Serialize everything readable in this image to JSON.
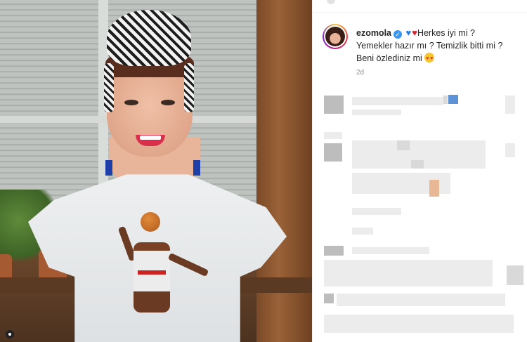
{
  "post": {
    "username": "ezomola",
    "verified": true,
    "caption_line1": "Herkes iyi mi ?",
    "caption_line2": "Yemekler hazır mı ? Temizlik bitti mi ?",
    "caption_line3": "Beni özlediniz mi",
    "timestamp": "2d"
  },
  "icons": {
    "verified": "verified-badge-icon",
    "heart_blue": "blue-heart-emoji",
    "heart_red": "red-heart-emoji",
    "heart_eyes": "heart-eyes-emoji",
    "photo_corner": "instagram-profile-icon"
  },
  "colors": {
    "text": "#262626",
    "muted": "#8e8e8e",
    "verified_blue": "#3897f0",
    "border": "#efefef"
  }
}
